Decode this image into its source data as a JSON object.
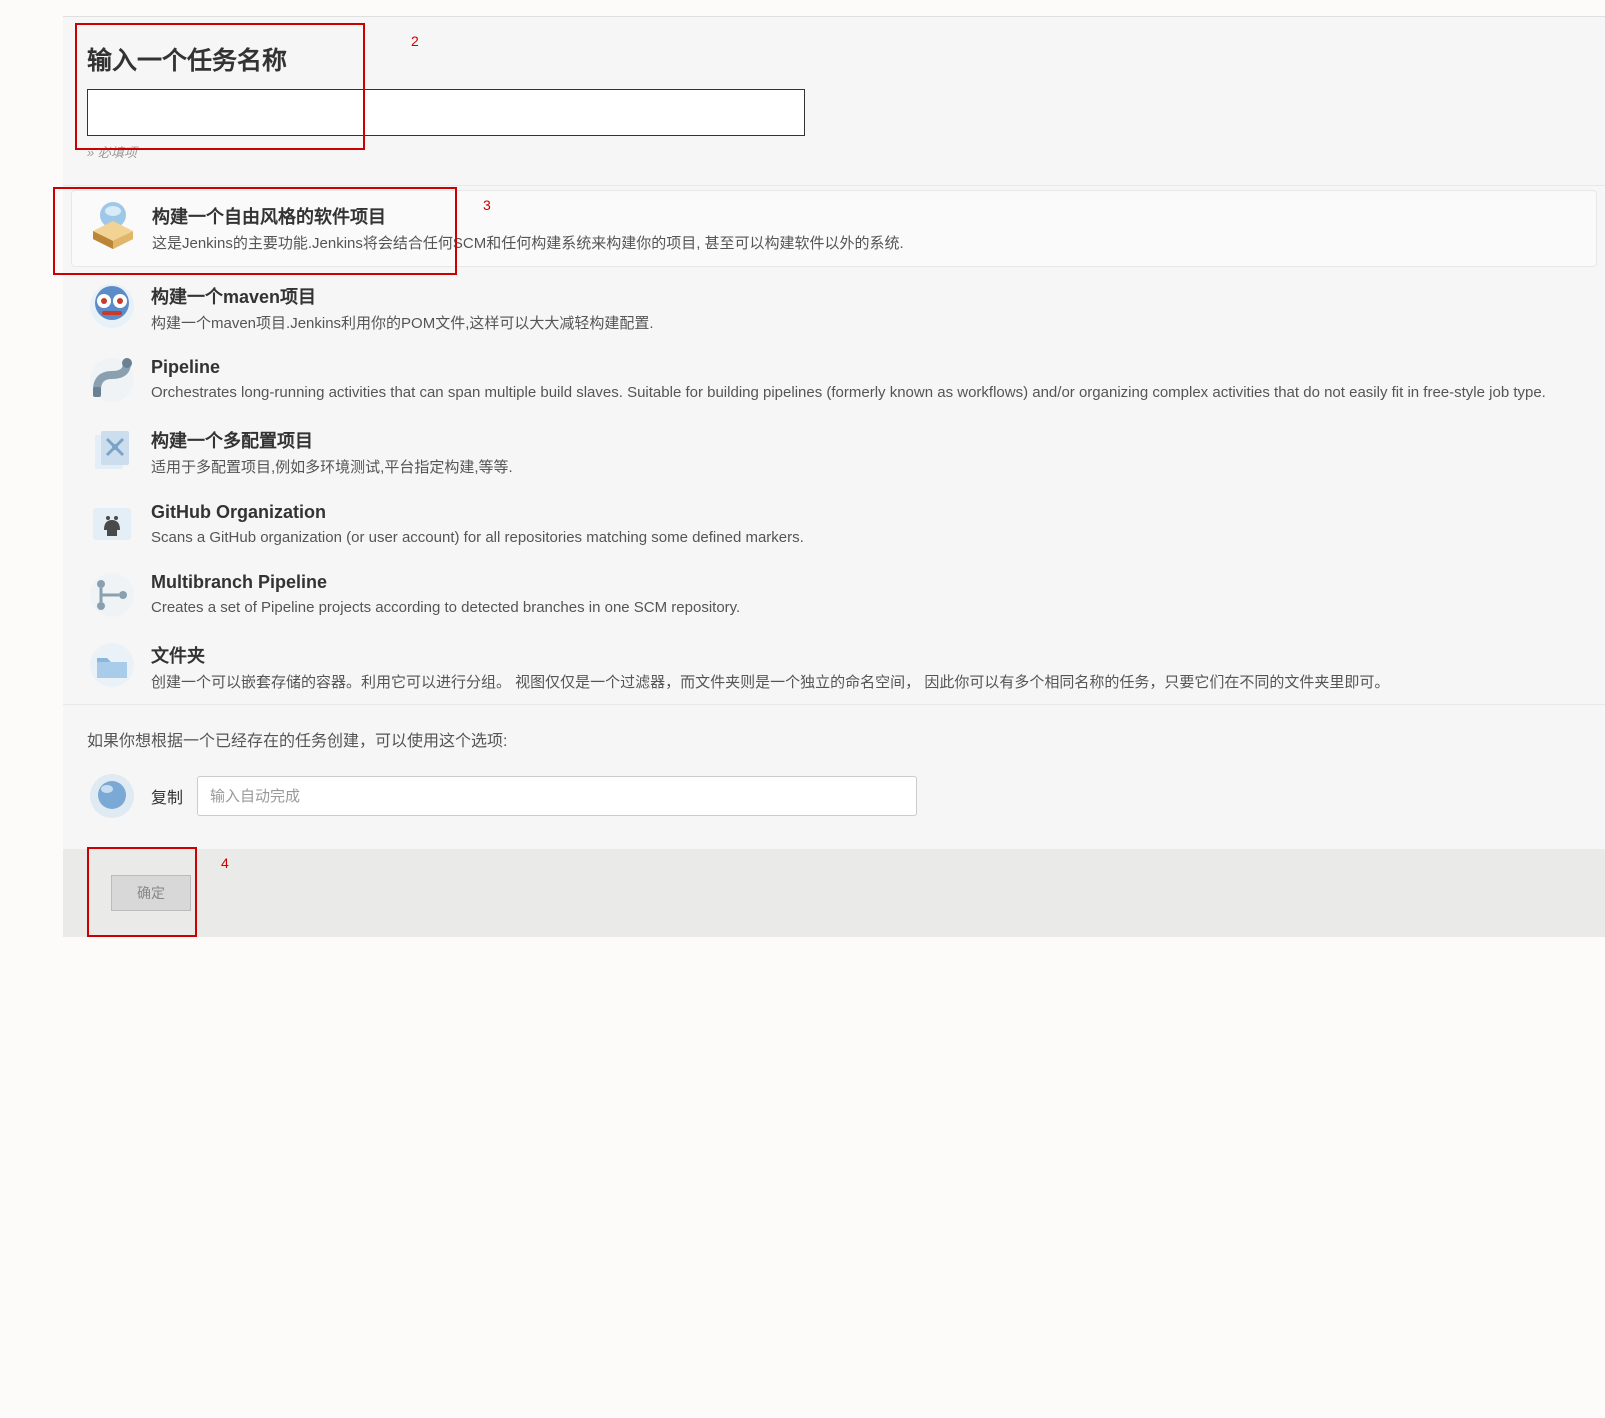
{
  "header": {
    "title": "输入一个任务名称",
    "required_note": "» 必填项"
  },
  "annotations": {
    "label2": "2",
    "label3": "3",
    "label4": "4"
  },
  "items": [
    {
      "icon": "box-icon",
      "title": "构建一个自由风格的软件项目",
      "desc": "这是Jenkins的主要功能.Jenkins将会结合任何SCM和任何构建系统来构建你的项目, 甚至可以构建软件以外的系统.",
      "selected": true
    },
    {
      "icon": "maven-icon",
      "title": "构建一个maven项目",
      "desc": "构建一个maven项目.Jenkins利用你的POM文件,这样可以大大减轻构建配置."
    },
    {
      "icon": "pipeline-icon",
      "title": "Pipeline",
      "desc": "Orchestrates long-running activities that can span multiple build slaves. Suitable for building pipelines (formerly known as workflows) and/or organizing complex activities that do not easily fit in free-style job type."
    },
    {
      "icon": "multiconfig-icon",
      "title": "构建一个多配置项目",
      "desc": "适用于多配置项目,例如多环境测试,平台指定构建,等等."
    },
    {
      "icon": "github-icon",
      "title": "GitHub Organization",
      "desc": "Scans a GitHub organization (or user account) for all repositories matching some defined markers."
    },
    {
      "icon": "multibranch-icon",
      "title": "Multibranch Pipeline",
      "desc": "Creates a set of Pipeline projects according to detected branches in one SCM repository."
    },
    {
      "icon": "folder-icon",
      "title": "文件夹",
      "desc": "创建一个可以嵌套存储的容器。利用它可以进行分组。 视图仅仅是一个过滤器，而文件夹则是一个独立的命名空间， 因此你可以有多个相同名称的任务，只要它们在不同的文件夹里即可。"
    }
  ],
  "copy": {
    "hint": "如果你想根据一个已经存在的任务创建，可以使用这个选项:",
    "label": "复制",
    "placeholder": "输入自动完成"
  },
  "footer": {
    "ok_label": "确定"
  }
}
